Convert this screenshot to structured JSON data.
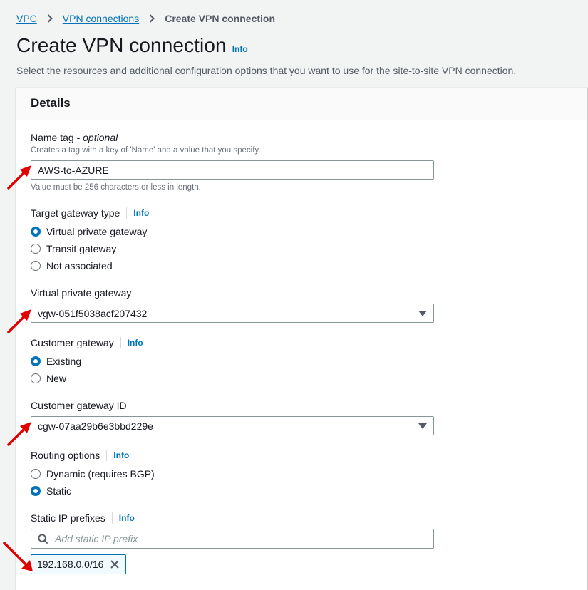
{
  "breadcrumb": {
    "items": [
      "VPC",
      "VPN connections"
    ],
    "current": "Create VPN connection"
  },
  "page": {
    "title": "Create VPN connection",
    "info": "Info",
    "description": "Select the resources and additional configuration options that you want to use for the site-to-site VPN connection."
  },
  "details": {
    "header": "Details",
    "name_tag": {
      "label": "Name tag - ",
      "optional": "optional",
      "description": "Creates a tag with a key of 'Name' and a value that you specify.",
      "value": "AWS-to-AZURE",
      "constraint": "Value must be 256 characters or less in length."
    },
    "target_gateway_type": {
      "label": "Target gateway type",
      "info": "Info",
      "options": [
        "Virtual private gateway",
        "Transit gateway",
        "Not associated"
      ],
      "selected": "Virtual private gateway"
    },
    "virtual_private_gateway": {
      "label": "Virtual private gateway",
      "value": "vgw-051f5038acf207432"
    },
    "customer_gateway": {
      "label": "Customer gateway",
      "info": "Info",
      "options": [
        "Existing",
        "New"
      ],
      "selected": "Existing"
    },
    "customer_gateway_id": {
      "label": "Customer gateway ID",
      "value": "cgw-07aa29b6e3bbd229e"
    },
    "routing_options": {
      "label": "Routing options",
      "info": "Info",
      "options": [
        "Dynamic (requires BGP)",
        "Static"
      ],
      "selected": "Static"
    },
    "static_ip_prefixes": {
      "label": "Static IP prefixes",
      "info": "Info",
      "placeholder": "Add static IP prefix",
      "tokens": [
        "192.168.0.0/16"
      ]
    }
  },
  "colors": {
    "link": "#0073bb",
    "annotation_arrow": "#e00000"
  }
}
